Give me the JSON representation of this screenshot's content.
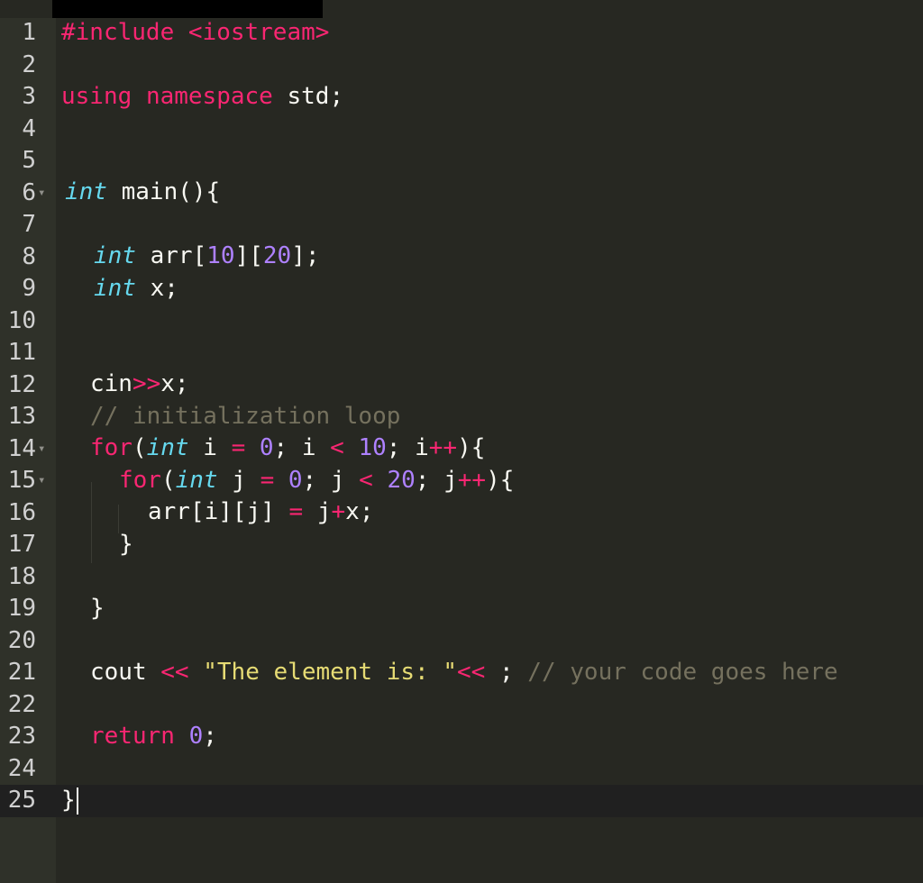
{
  "editor": {
    "colors": {
      "background": "#272822",
      "gutter": "#2f3129",
      "keyword": "#f92672",
      "type": "#66d9ef",
      "number": "#ae81ff",
      "string": "#e6db74",
      "comment": "#75715e",
      "text": "#f8f8f2"
    },
    "cursor_line": 25,
    "lines": [
      {
        "n": "1"
      },
      {
        "n": "2"
      },
      {
        "n": "3"
      },
      {
        "n": "4"
      },
      {
        "n": "5"
      },
      {
        "n": "6"
      },
      {
        "n": "7"
      },
      {
        "n": "8"
      },
      {
        "n": "9"
      },
      {
        "n": "10"
      },
      {
        "n": "11"
      },
      {
        "n": "12"
      },
      {
        "n": "13"
      },
      {
        "n": "14"
      },
      {
        "n": "15"
      },
      {
        "n": "16"
      },
      {
        "n": "17"
      },
      {
        "n": "18"
      },
      {
        "n": "19"
      },
      {
        "n": "20"
      },
      {
        "n": "21"
      },
      {
        "n": "22"
      },
      {
        "n": "23"
      },
      {
        "n": "24"
      },
      {
        "n": "25"
      }
    ],
    "tokens": {
      "l1_kw": "#include",
      "l1_str": "<iostream>",
      "l3_kw1": "using",
      "l3_kw2": "namespace",
      "l3_rest": "std;",
      "l6_ty": "int",
      "l6_rest": "main(){",
      "l8_ty": "int",
      "l8_a": "arr[",
      "l8_n1": "10",
      "l8_b": "][",
      "l8_n2": "20",
      "l8_c": "];",
      "l9_ty": "int",
      "l9_rest": "x;",
      "l12_a": "cin",
      "l12_op": ">>",
      "l12_b": "x;",
      "l13_cmt": "// initialization loop",
      "l14_kw": "for",
      "l14_a": "(",
      "l14_ty": "int",
      "l14_b": "i",
      "l14_eq": "=",
      "l14_n1": "0",
      "l14_c": "; i",
      "l14_lt": "<",
      "l14_n2": "10",
      "l14_d": "; i",
      "l14_pp": "++",
      "l14_e": "){",
      "l15_kw": "for",
      "l15_a": "(",
      "l15_ty": "int",
      "l15_b": "j",
      "l15_eq": "=",
      "l15_n1": "0",
      "l15_c": "; j",
      "l15_lt": "<",
      "l15_n2": "20",
      "l15_d": "; j",
      "l15_pp": "++",
      "l15_e": "){",
      "l16_a": "arr[i][j]",
      "l16_eq": "=",
      "l16_b": "j",
      "l16_plus": "+",
      "l16_c": "x;",
      "l17": "}",
      "l19": "}",
      "l21_a": "cout",
      "l21_op1": "<<",
      "l21_str": "\"The element is: \"",
      "l21_op2": "<<",
      "l21_b": ";",
      "l21_cmt": "// your code goes here",
      "l23_kw": "return",
      "l23_n": "0",
      "l23_b": ";",
      "l25": "}"
    }
  }
}
